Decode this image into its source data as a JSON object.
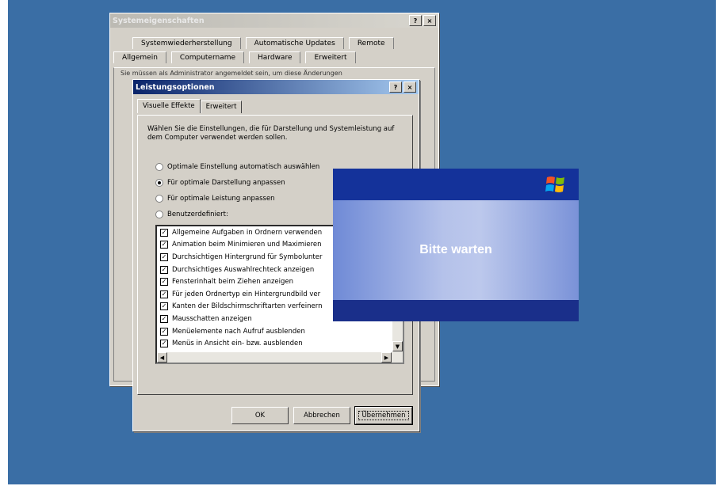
{
  "back_dialog": {
    "title": "Systemeigenschaften",
    "help": "?",
    "close": "×",
    "tabs_row1": [
      "Systemwiederherstellung",
      "Automatische Updates",
      "Remote"
    ],
    "tabs_row2": [
      "Allgemein",
      "Computername",
      "Hardware",
      "Erweitert"
    ],
    "body_text": "Sie müssen als Administrator angemeldet sein, um diese Änderungen"
  },
  "front_dialog": {
    "title": "Leistungsoptionen",
    "help": "?",
    "close": "×",
    "tabs": [
      "Visuelle Effekte",
      "Erweitert"
    ],
    "description": "Wählen Sie die Einstellungen, die für Darstellung und Systemleistung auf dem Computer verwendet werden sollen.",
    "radios": [
      {
        "label": "Optimale Einstellung automatisch auswählen",
        "checked": false
      },
      {
        "label": "Für optimale Darstellung anpassen",
        "checked": true
      },
      {
        "label": "Für optimale Leistung anpassen",
        "checked": false
      },
      {
        "label": "Benutzerdefiniert:",
        "checked": false
      }
    ],
    "list_items": [
      "Allgemeine Aufgaben in Ordnern verwenden",
      "Animation beim Minimieren und Maximieren",
      "Durchsichtigen Hintergrund für Symbolunter",
      "Durchsichtiges Auswahlrechteck anzeigen",
      "Fensterinhalt beim Ziehen anzeigen",
      "Für jeden Ordnertyp ein Hintergrundbild ver",
      "Kanten der Bildschirmschriftarten verfeinern",
      "Mausschatten anzeigen",
      "Menüelemente nach Aufruf ausblenden",
      "Menüs in Ansicht ein- bzw. ausblenden"
    ],
    "check_mark": "✓",
    "buttons": {
      "ok": "OK",
      "cancel": "Abbrechen",
      "apply": "Übernehmen"
    }
  },
  "splash": {
    "text": "Bitte warten",
    "logo_icon": "windows-logo-icon"
  },
  "colors": {
    "desktop": "#3a6ea5",
    "splash_bg": "#0c2a8f",
    "title_active": "#0a246a"
  }
}
